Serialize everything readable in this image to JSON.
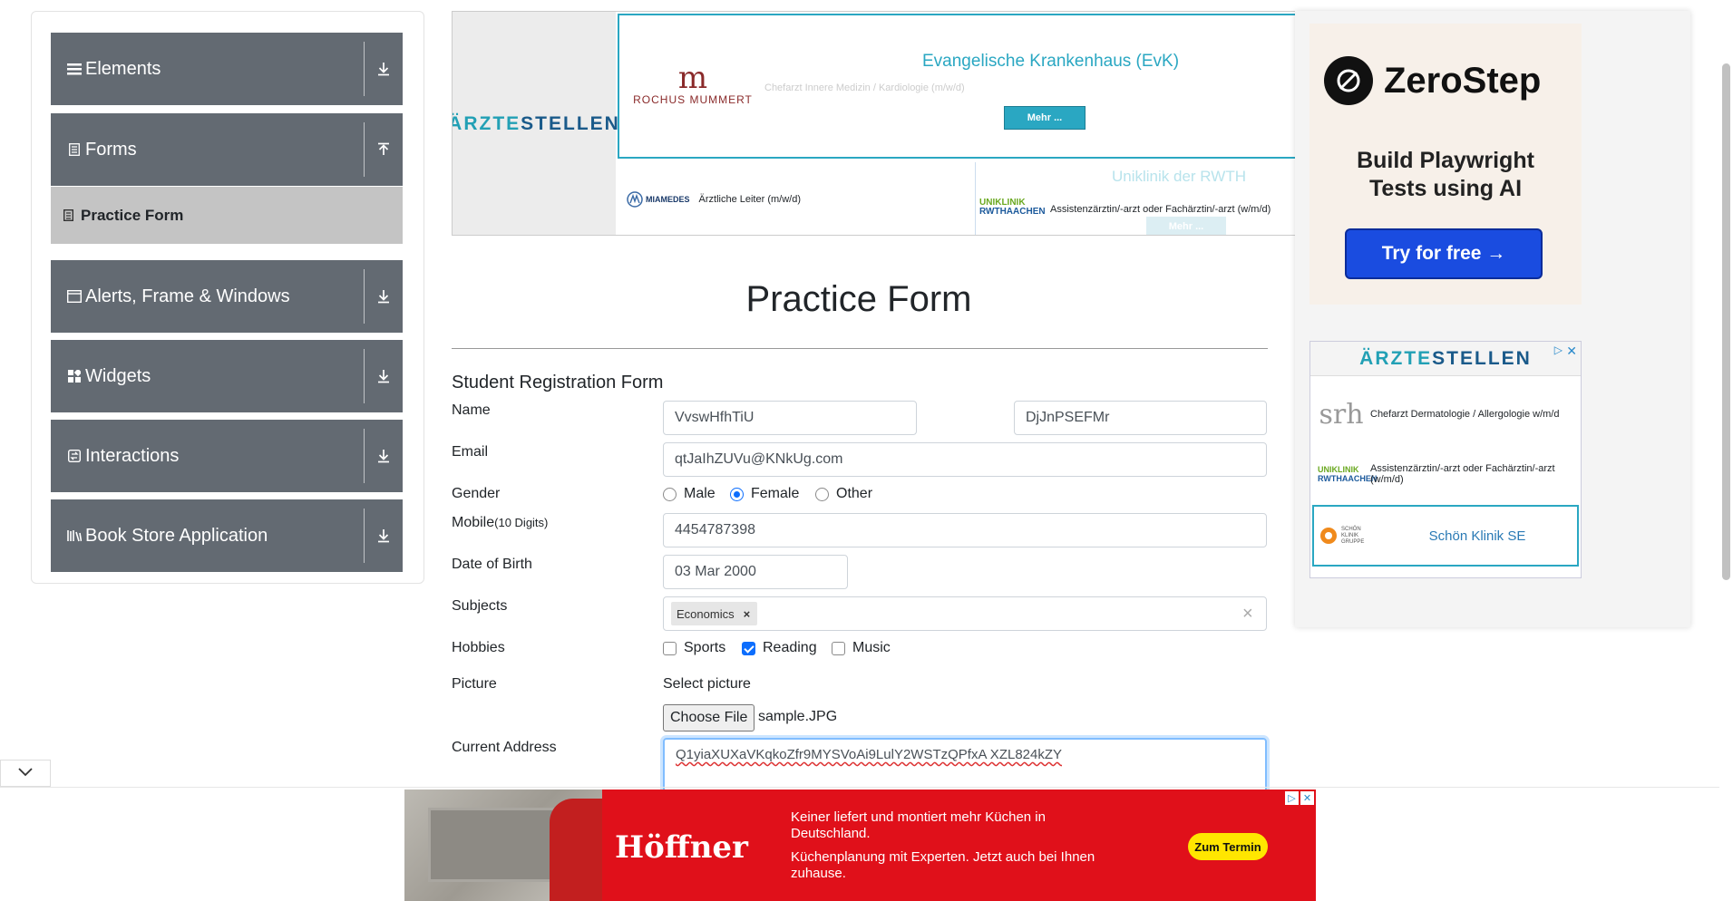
{
  "sidebar": {
    "groups": [
      {
        "label": "Elements",
        "icon": "hamburger-icon",
        "arrow": "download-arrow-icon"
      },
      {
        "label": "Forms",
        "icon": "form-icon",
        "arrow": "upload-arrow-icon"
      },
      {
        "label": "Alerts, Frame & Windows",
        "icon": "window-icon",
        "arrow": "download-arrow-icon"
      },
      {
        "label": "Widgets",
        "icon": "widgets-icon",
        "arrow": "download-arrow-icon"
      },
      {
        "label": "Interactions",
        "icon": "interactions-icon",
        "arrow": "download-arrow-icon"
      },
      {
        "label": "Book Store Application",
        "icon": "books-icon",
        "arrow": "download-arrow-icon"
      }
    ],
    "active_item": "Practice Form"
  },
  "top_ad": {
    "brand_prefix": "ÄRZTE",
    "brand_suffix": "STELLEN",
    "main_logo_mark": "m",
    "main_logo_text": "ROCHUS MUMMERT",
    "main_title": "Evangelische Krankenhaus (EvK)",
    "main_subtitle": "Chefarzt Innere Medizin / Kardiologie (m/w/d)",
    "main_button": "Mehr ...",
    "b1_logo": "MIAMEDES",
    "b1_text": "Ärztliche Leiter (m/w/d)",
    "b2_logo_top": "UNIKLINIK",
    "b2_logo_bottom": "RWTHAACHEN",
    "b2_title": "Uniklinik der RWTH",
    "b2_text": "Assistenzärztin/-arzt oder Fachärztin/-arzt (w/m/d)",
    "b2_button": "Mehr ..."
  },
  "form": {
    "page_title": "Practice Form",
    "section_title": "Student Registration Form",
    "name_label": "Name",
    "first_name": "VvswHfhTiU",
    "last_name": "DjJnPSEFMr",
    "email_label": "Email",
    "email": "qtJaIhZUVu@KNkUg.com",
    "gender_label": "Gender",
    "gender_options": [
      "Male",
      "Female",
      "Other"
    ],
    "gender_selected": "Female",
    "mobile_label": "Mobile",
    "mobile_hint": "(10 Digits)",
    "mobile": "4454787398",
    "dob_label": "Date of Birth",
    "dob": "03 Mar 2000",
    "subjects_label": "Subjects",
    "subjects": [
      "Economics"
    ],
    "chip_remove": "×",
    "clear_all": "×",
    "hobbies_label": "Hobbies",
    "hobbies": [
      {
        "label": "Sports",
        "checked": false
      },
      {
        "label": "Reading",
        "checked": true
      },
      {
        "label": "Music",
        "checked": false
      }
    ],
    "picture_label": "Picture",
    "select_picture": "Select picture",
    "choose_file": "Choose File",
    "file_name": "sample.JPG",
    "address_label": "Current Address",
    "address": "Q1yiaXUXaVKqkoZfr9MYSVoAi9LulY2WSTzQPfxA XZL824kZY"
  },
  "right_ads": {
    "zerostep_name": "ZeroStep",
    "zerostep_tagline_1": "Build Playwright",
    "zerostep_tagline_2": "Tests using AI",
    "zerostep_button": "Try for free →",
    "az_brand_prefix": "ÄRZTE",
    "az_brand_suffix": "STELLEN",
    "az_row1_logo": "srh",
    "az_row1_text": "Chefarzt Dermatologie / Allergologie w/m/d",
    "az_row2_logo_top": "UNIKLINIK",
    "az_row2_logo_bottom": "RWTHAACHEN",
    "az_row2_text": "Assistenzärztin/-arzt oder Fachärztin/-arzt (w/m/d)",
    "az_row3_logo": "SCHÖN KLINIK GRUPPE",
    "az_row3_text": "Schön Klinik SE"
  },
  "bottom_ad": {
    "brand": "Höffner",
    "line1": "Keiner liefert und montiert mehr Küchen in Deutschland.",
    "line2": "Küchenplanung mit Experten. Jetzt auch bei Ihnen zuhause.",
    "button": "Zum Termin"
  },
  "colors": {
    "sidebar_group": "#636a72",
    "active_item": "#c4c4c4",
    "accent": "#0d6efd",
    "ad_teal": "#2aa7c2",
    "hoffner_red": "#e0101a"
  }
}
